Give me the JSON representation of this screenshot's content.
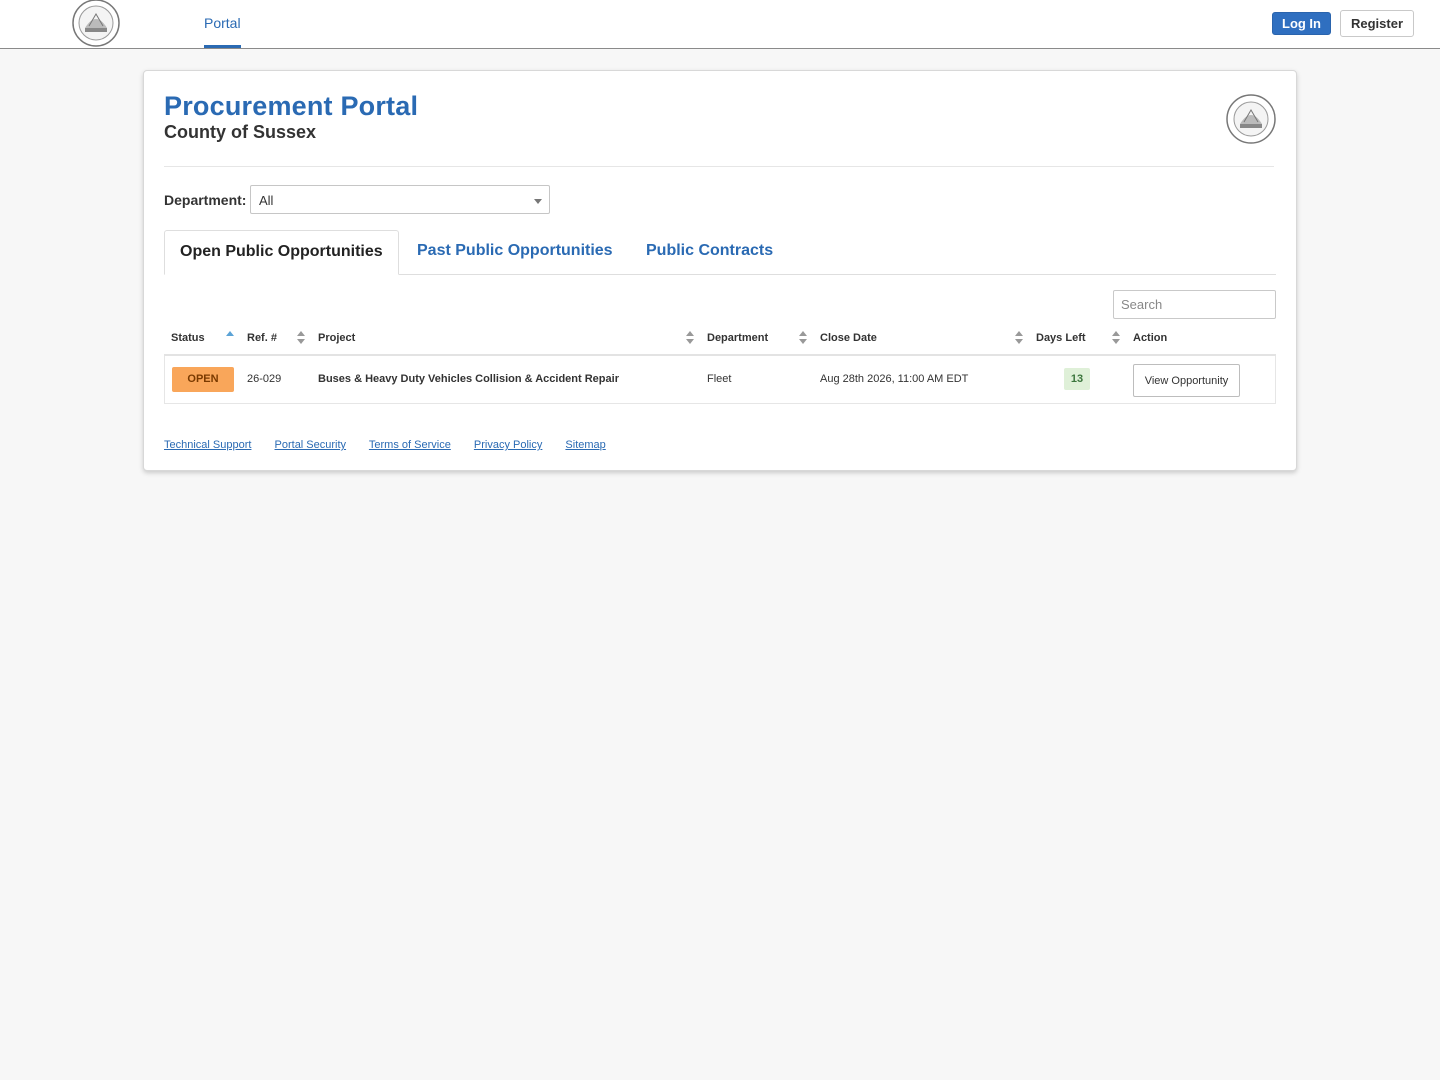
{
  "nav": {
    "portal_label": "Portal",
    "login_label": "Log In",
    "register_label": "Register",
    "accent_color": "#2a6ab3"
  },
  "header": {
    "title": "Procurement Portal",
    "subtitle": "County of Sussex",
    "seal_icon": "county-seal-icon"
  },
  "filter": {
    "department_label": "Department:",
    "department_value": "All"
  },
  "tabs": [
    {
      "label": "Open Public Opportunities",
      "active": true
    },
    {
      "label": "Past Public Opportunities",
      "active": false
    },
    {
      "label": "Public Contracts",
      "active": false
    }
  ],
  "search": {
    "placeholder": "Search"
  },
  "table": {
    "columns": [
      "Status",
      "Ref. #",
      "Project",
      "Department",
      "Close Date",
      "Days Left",
      "Action"
    ],
    "rows": [
      {
        "status": "OPEN",
        "ref": "26-029",
        "project": "Buses & Heavy Duty Vehicles Collision & Accident Repair",
        "department": "Fleet",
        "close_date": "Aug 28th 2026, 11:00 AM EDT",
        "days_left": "13",
        "action": "View Opportunity"
      }
    ],
    "status_color": "#f9a65a"
  },
  "footer": {
    "links": [
      "Technical Support",
      "Portal Security",
      "Terms of Service",
      "Privacy Policy",
      "Sitemap"
    ]
  }
}
